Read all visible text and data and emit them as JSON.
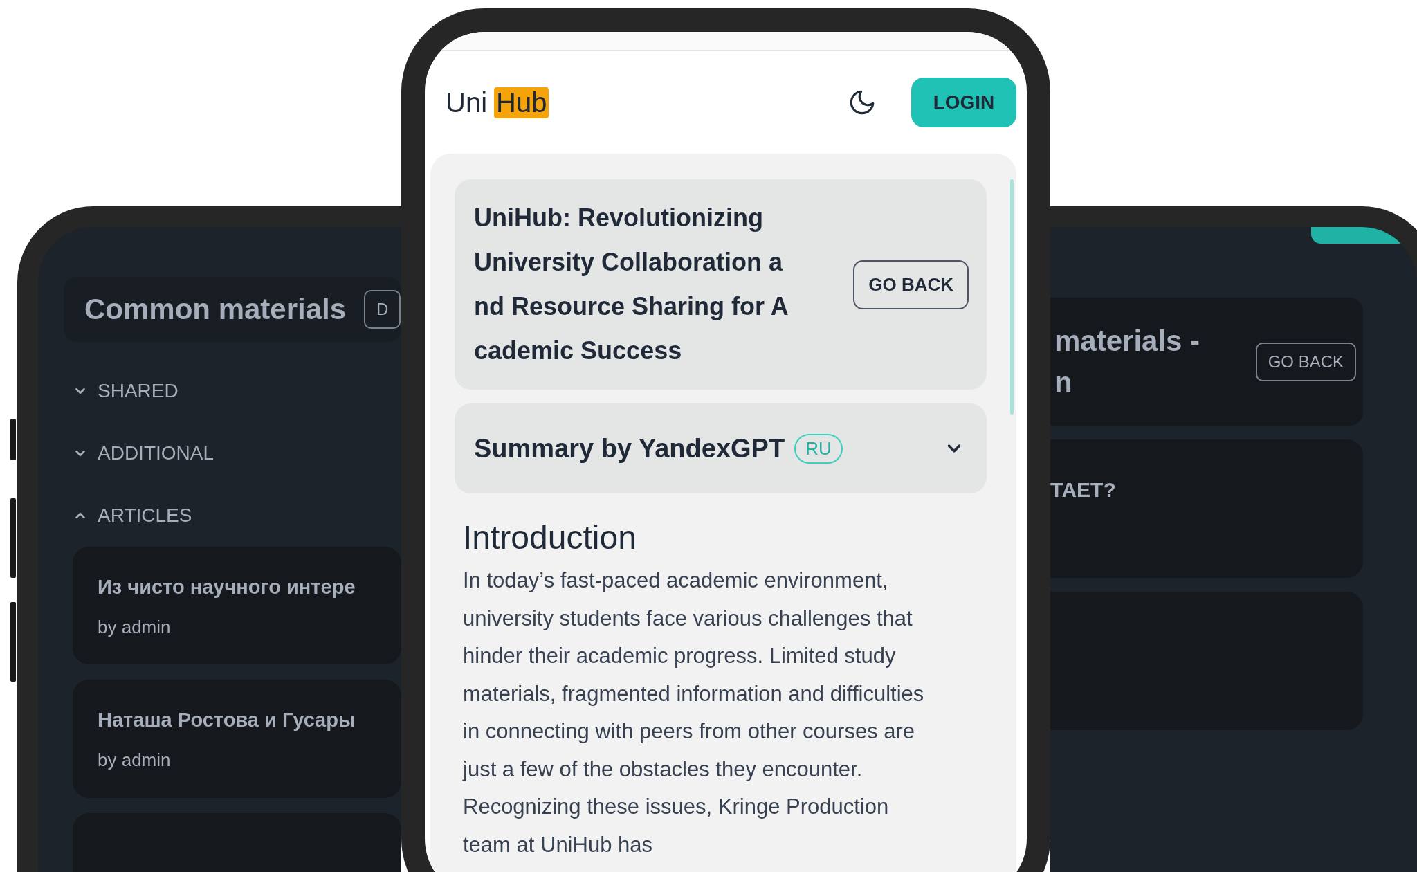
{
  "back_left": {
    "header": {
      "title": "Common materials",
      "button": "D"
    },
    "sections": [
      {
        "label": "SHARED",
        "expanded": false
      },
      {
        "label": "ADDITIONAL",
        "expanded": false
      },
      {
        "label": "ARTICLES",
        "expanded": true
      }
    ],
    "articles": [
      {
        "title": "Из чисто научного интере",
        "author": "by admin"
      },
      {
        "title": "Наташа Ростова и Гусары",
        "author": "by admin"
      }
    ]
  },
  "back_right": {
    "header": {
      "title_lines": [
        "materials -",
        "n"
      ],
      "button": "GO BACK"
    },
    "cards": [
      {
        "title": "ТАЕТ?"
      }
    ]
  },
  "front": {
    "logo": {
      "first": "Uni",
      "highlight": "Hub"
    },
    "login_button": "LOGIN",
    "article": {
      "title_lines": [
        "UniHub: Revolutionizing",
        "University Collaboration a",
        "nd Resource Sharing for A",
        "cademic Success"
      ],
      "back_button": "GO BACK"
    },
    "summary": {
      "title": "Summary by YandexGPT",
      "badge": "RU",
      "expanded": false
    },
    "section": {
      "heading": "Introduction",
      "text": "In today’s fast-paced academic environment, university students face various challenges that hinder their academic progress. Limited study materials, fragmented information and difficulties in connecting with peers from other courses are just a few of the obstacles they encounter. Recognizing these issues, Kringe Production team at UniHub has"
    }
  }
}
